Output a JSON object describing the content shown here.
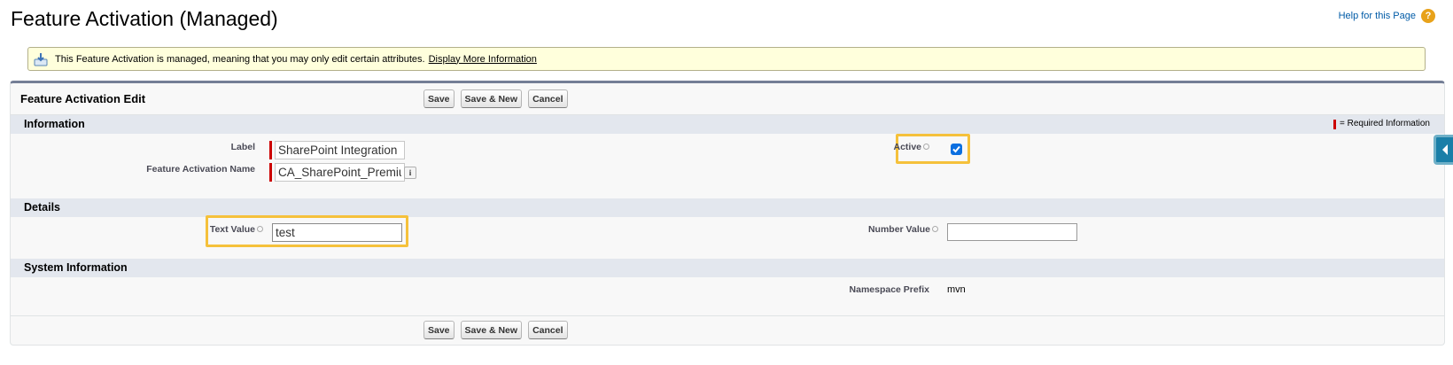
{
  "page": {
    "title": "Feature Activation (Managed)",
    "help_link": "Help for this Page",
    "help_icon": "?"
  },
  "banner": {
    "text": "This Feature Activation is managed, meaning that you may only edit certain attributes.",
    "link": "Display More Information",
    "icon": "managed-package-icon"
  },
  "panel": {
    "title": "Feature Activation Edit",
    "buttons": {
      "save": "Save",
      "save_new": "Save & New",
      "cancel": "Cancel"
    }
  },
  "sections": {
    "information": {
      "title": "Information",
      "required_legend": "= Required Information",
      "fields": {
        "label": {
          "label": "Label",
          "value": "SharePoint Integration P"
        },
        "name": {
          "label": "Feature Activation Name",
          "value": "CA_SharePoint_Premiur",
          "info_icon": "i"
        },
        "active": {
          "label": "Active",
          "checked": true
        }
      }
    },
    "details": {
      "title": "Details",
      "fields": {
        "text_value": {
          "label": "Text Value",
          "value": "test"
        },
        "number_value": {
          "label": "Number Value",
          "value": ""
        }
      }
    },
    "system": {
      "title": "System Information",
      "fields": {
        "namespace_prefix": {
          "label": "Namespace Prefix",
          "value": "mvn"
        }
      }
    }
  },
  "colors": {
    "required": "#cc0000",
    "highlight": "#f5c13b",
    "section_bg": "#e3e7ee",
    "banner_bg": "#ffffdc",
    "checkbox": "#0b6fe0"
  }
}
